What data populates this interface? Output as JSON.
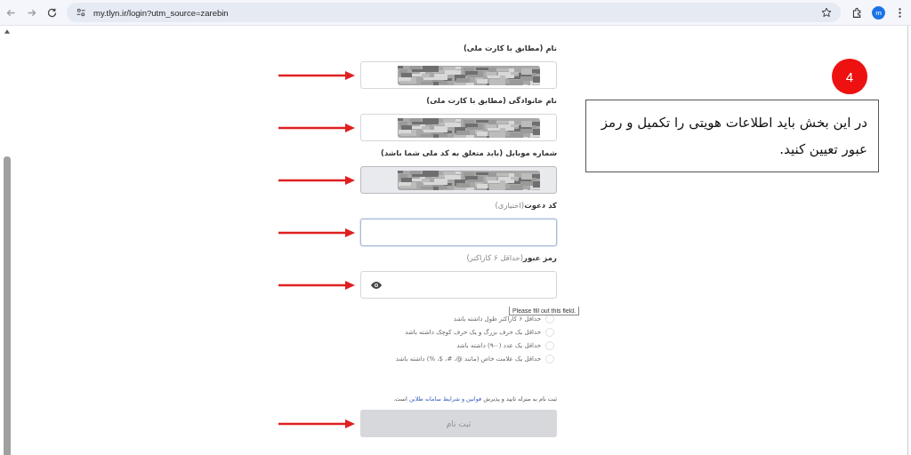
{
  "browser": {
    "url": "my.tlyn.ir/login?utm_source=zarebin",
    "profile_initial": "m"
  },
  "form": {
    "fields": [
      {
        "label": "نام (مطابق با کارت ملی)",
        "kind": "blurred",
        "disabled": false,
        "focused": false
      },
      {
        "label": "نام خانوادگی (مطابق با کارت ملی)",
        "kind": "blurred",
        "disabled": false,
        "focused": false
      },
      {
        "label": "شماره موبایل (باید متعلق به کد ملی شما باشد)",
        "kind": "blurred",
        "disabled": true,
        "focused": false
      },
      {
        "label": "کد دعوت",
        "hint": "(اختیاری)",
        "kind": "text",
        "disabled": false,
        "focused": true
      },
      {
        "label": "رمز عبور",
        "hint": "(حداقل ۶ کاراکتر)",
        "kind": "password",
        "disabled": false,
        "focused": false
      }
    ],
    "rules": [
      {
        "text": "حداقل ۶ کاراکتر طول داشته باشد",
        "checked": false
      },
      {
        "text": "حداقل یک حرف بزرگ و یک حرف کوچک داشته باشد",
        "checked": false
      },
      {
        "text": "حداقل یک عدد (۰-۹) داشته باشد",
        "checked": false
      },
      {
        "text": "حداقل یک علامت خاص (مانند @، #، $، %) داشته باشد",
        "checked": false
      }
    ],
    "terms": {
      "before": "ثبت نام به منزله تایید و پذیرش",
      "link": "قوانین و شرایط سامانه طلاین",
      "after": "است."
    },
    "submit": {
      "label": "ثبت نام",
      "disabled": true
    },
    "tooltip": "Please fill out this field."
  },
  "annotation": {
    "step": "4",
    "text": "در این بخش باید اطلاعات هویتی را تکمیل و رمز عبور تعیین کنید."
  }
}
